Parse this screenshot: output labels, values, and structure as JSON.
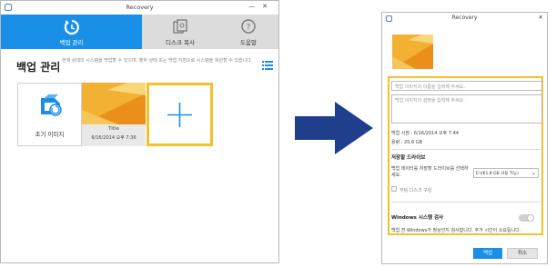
{
  "left_window": {
    "title": "Recovery",
    "tabs": [
      {
        "label": "백업 관리",
        "icon": "backup-restore-icon",
        "active": true
      },
      {
        "label": "디스크 복사",
        "icon": "disk-copy-icon",
        "active": false
      },
      {
        "label": "도움말",
        "icon": "help-icon",
        "active": false
      }
    ],
    "section_title": "백업 관리",
    "section_desc": "현재 상태의 시스템을 백업할 수 있으며, 출하 상태 또는 백업 지점으로 시스템을 복원할 수 있습니다.",
    "tiles": {
      "initial_image_label": "초기 이미지",
      "backup_title": "Title",
      "backup_date": "6/16/2014 오후 7:36"
    }
  },
  "right_window": {
    "title": "Recovery",
    "name_placeholder": "백업 이미지의 이름을 입력해 주세요.",
    "desc_placeholder": "백업 이미지의 설명을 입력해 주세요.",
    "backup_time": "백업 시점 : 6/16/2014 오후 7:44",
    "capacity": "용량 : 20.6 GB",
    "storage_heading": "저장할 드라이브",
    "storage_prompt": "백업 데이터를 저장할 드라이브를 선택하세요.",
    "drive_selected": "E:\\(61.8 GB 사용 가능)",
    "bootdisk_label": "부팅 디스크 구성",
    "windows_check_heading": "Windows 시스템 검사",
    "windows_check_desc": "백업 전 Windows가 정상인지 검사합니다. 추가 시간이 소요됩니다.",
    "buttons": {
      "backup": "백업",
      "cancel": "취소"
    }
  },
  "colors": {
    "accent_blue": "#1a8fe8",
    "highlight_yellow": "#f3c12a",
    "arrow_navy": "#1f3f8c",
    "wallpaper_orange": "#f0a020"
  }
}
